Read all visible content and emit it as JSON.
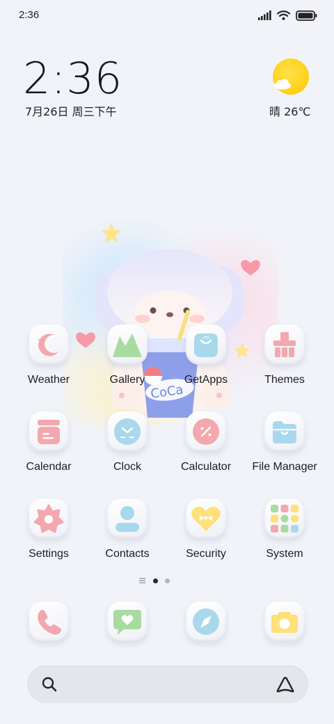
{
  "status_bar": {
    "time": "2:36",
    "icons": [
      "signal-icon",
      "wifi-icon",
      "battery-icon"
    ]
  },
  "clock_widget": {
    "time": "2:36",
    "date": "7月26日 周三下午",
    "weather": "晴 26℃",
    "weather_icon": "sunny-cloud-icon"
  },
  "wallpaper": {
    "cup_text": "CoCa"
  },
  "apps": [
    {
      "label": "Weather",
      "icon": "weather-moon-icon"
    },
    {
      "label": "Gallery",
      "icon": "gallery-icon"
    },
    {
      "label": "GetApps",
      "icon": "getapps-bag-icon"
    },
    {
      "label": "Themes",
      "icon": "themes-brush-icon"
    },
    {
      "label": "Calendar",
      "icon": "calendar-icon"
    },
    {
      "label": "Clock",
      "icon": "clock-icon"
    },
    {
      "label": "Calculator",
      "icon": "calculator-icon"
    },
    {
      "label": "File Manager",
      "icon": "folder-icon"
    },
    {
      "label": "Settings",
      "icon": "settings-flower-icon"
    },
    {
      "label": "Contacts",
      "icon": "contacts-icon"
    },
    {
      "label": "Security",
      "icon": "security-heart-icon"
    },
    {
      "label": "System",
      "icon": "system-folder-icon"
    }
  ],
  "dock": [
    {
      "icon": "phone-icon"
    },
    {
      "icon": "messages-icon"
    },
    {
      "icon": "browser-compass-icon"
    },
    {
      "icon": "camera-icon"
    }
  ],
  "page_indicator": {
    "pages": 2,
    "current": 1
  },
  "search_bar": {
    "left_icon": "search-icon",
    "right_icon": "assistant-icon"
  },
  "colors": {
    "background": "#f1f3f8",
    "pink": "#f4a7ae",
    "green": "#a9dba1",
    "blue": "#a9d8ec",
    "yellow": "#ffe07a",
    "sun": "#ffcf1a"
  }
}
